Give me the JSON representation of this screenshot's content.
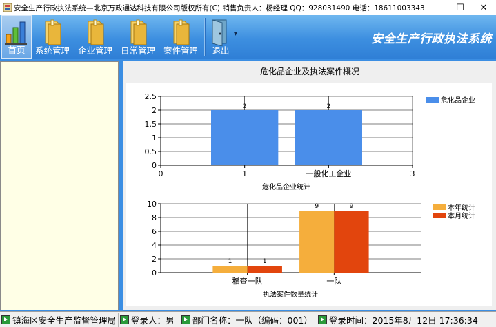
{
  "window": {
    "title": "安全生产行政执法系统—北京万政通达科技有限公司版权所有(C) 销售负责人：杨经理 QQ：928031490 电话：18611003343",
    "minimize": "—",
    "maximize": "☐",
    "close": "✕"
  },
  "toolbar": {
    "items": [
      {
        "label": "首页",
        "icon": "chart-home-icon"
      },
      {
        "label": "系统管理",
        "icon": "folder-icon"
      },
      {
        "label": "企业管理",
        "icon": "folder-icon"
      },
      {
        "label": "日常管理",
        "icon": "folder-icon"
      },
      {
        "label": "案件管理",
        "icon": "folder-icon"
      },
      {
        "label": "退出",
        "icon": "exit-door-icon"
      }
    ],
    "dropdown": "▾",
    "brand": "安全生产行政执法系统"
  },
  "main": {
    "panel_title": "危化品企业及执法案件概况"
  },
  "chart_data": [
    {
      "type": "bar",
      "title": "",
      "xlabel": "危化品企业统计",
      "x_ticks": [
        "0",
        "1",
        "一般化工企业",
        "3"
      ],
      "y_ticks": [
        "0",
        "0.5",
        "1",
        "1.5",
        "2",
        "2.5"
      ],
      "ylim": [
        0,
        2.5
      ],
      "categories": [
        "1",
        "一般化工企业"
      ],
      "series": [
        {
          "name": "危化品企业",
          "values": [
            2,
            2
          ],
          "color": "#4a8eea"
        }
      ],
      "data_labels": [
        "2",
        "2"
      ],
      "legend": "top-right"
    },
    {
      "type": "bar",
      "title": "",
      "xlabel": "执法案件数量统计",
      "y_ticks": [
        "0",
        "2",
        "4",
        "6",
        "8",
        "10"
      ],
      "ylim": [
        0,
        10
      ],
      "categories": [
        "稽查一队",
        "一队"
      ],
      "series": [
        {
          "name": "本年统计",
          "values": [
            1,
            9
          ],
          "color": "#f5ae3c"
        },
        {
          "name": "本月统计",
          "values": [
            1,
            9
          ],
          "color": "#e2450d"
        }
      ],
      "data_labels": [
        [
          "1",
          "1"
        ],
        [
          "9",
          "9"
        ]
      ],
      "legend": "top-right"
    }
  ],
  "status": {
    "org": "镇海区安全生产监督管理局",
    "user": "登录人：男",
    "dept": "部门名称：一队（编码：001）",
    "login_time": "登录时间：2015年8月12日 17:36:34"
  }
}
